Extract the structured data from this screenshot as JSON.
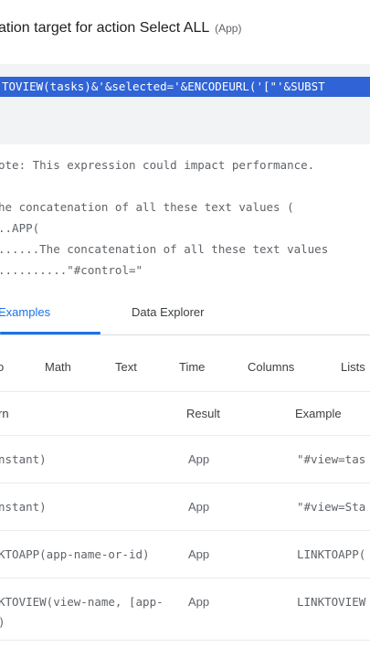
{
  "dialog": {
    "title": "ation target for action Select ALL",
    "title_sub": "(App)"
  },
  "expression": {
    "line": "TOVIEW(tasks)&'&selected='&ENCODEURL('[\"'&SUBST"
  },
  "help": {
    "note": "ote: This expression could impact performance.",
    "lines": [
      "he concatenation of all these text values (",
      "..APP(",
      "......The concatenation of all these text values",
      "..........\"#control=\""
    ]
  },
  "tabs": [
    {
      "label": "Examples",
      "active": true
    },
    {
      "label": "Data Explorer",
      "active": false
    }
  ],
  "categories": [
    "o",
    "Math",
    "Text",
    "Time",
    "Columns",
    "Lists"
  ],
  "table": {
    "headers": [
      "rn",
      "Result",
      "Example"
    ],
    "rows": [
      {
        "expr": "nstant)",
        "result": "App",
        "example": "\"#view=tas"
      },
      {
        "expr": "nstant)",
        "result": "App",
        "example": "\"#view=Sta"
      },
      {
        "expr": "KTOAPP(app-name-or-id)",
        "result": "App",
        "example": "LINKTOAPP("
      },
      {
        "expr": "KTOVIEW(view-name, [app-",
        "result": "App",
        "example": "LINKTOVIEW"
      },
      {
        "expr": ")",
        "result": "",
        "example": ""
      }
    ]
  }
}
